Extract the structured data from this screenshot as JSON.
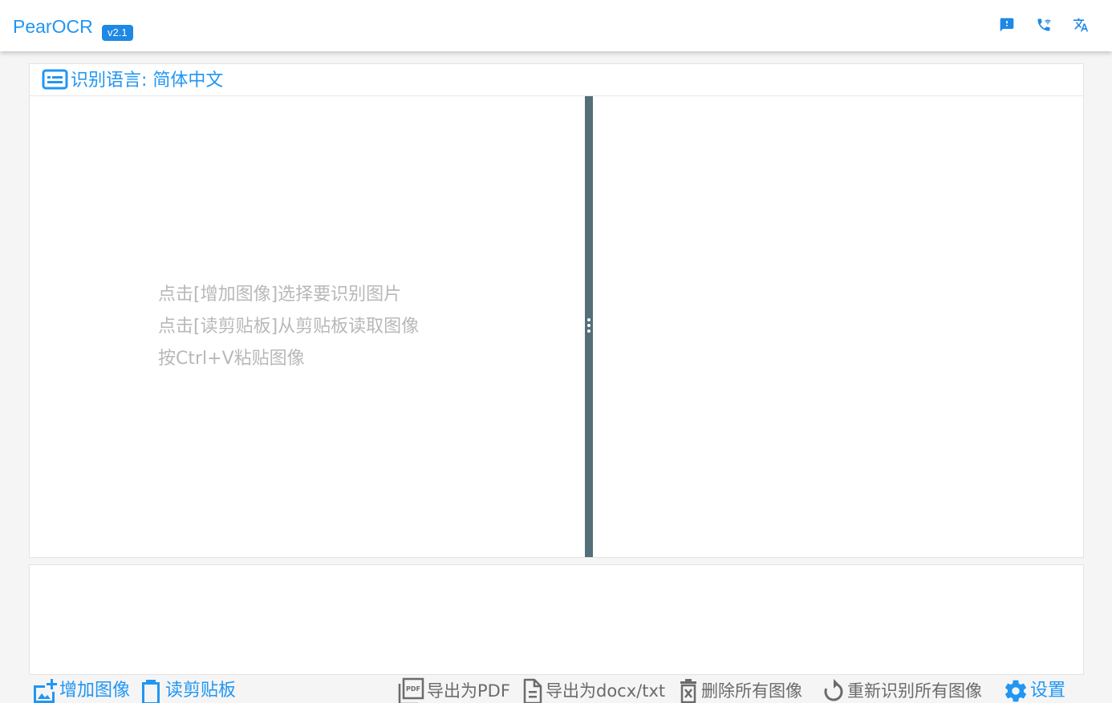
{
  "header": {
    "app_title": "PearOCR",
    "version": "v2.1",
    "icons": [
      "feedback-icon",
      "contact-phone-icon",
      "translate-icon"
    ]
  },
  "language": {
    "label": "识别语言: 简体中文",
    "icon": "subtitles-icon"
  },
  "hints": [
    "点击[增加图像]选择要识别图片",
    "点击[读剪贴板]从剪贴板读取图像",
    "按Ctrl+V粘贴图像"
  ],
  "toolbar": {
    "add_image": "增加图像",
    "read_clipboard": "读剪贴板",
    "export_pdf": "导出为PDF",
    "export_docx": "导出为docx/txt",
    "delete_all": "删除所有图像",
    "recognize_all": "重新识别所有图像",
    "settings": "设置"
  },
  "colors": {
    "accent": "#2196f3",
    "splitter": "#546e7a",
    "hint_text": "#b8b8b8",
    "toolbar_gray": "#6b6b6b"
  }
}
